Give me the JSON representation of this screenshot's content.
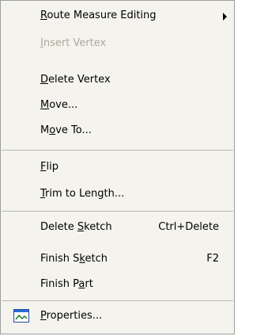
{
  "menu": {
    "route_measure_editing": {
      "label_pre": "",
      "label_u": "R",
      "label_post": "oute Measure Editing"
    },
    "insert_vertex": {
      "label_pre": "",
      "label_u": "I",
      "label_post": "nsert Vertex"
    },
    "delete_vertex": {
      "label_pre": "",
      "label_u": "D",
      "label_post": "elete Vertex"
    },
    "move": {
      "label_pre": "",
      "label_u": "M",
      "label_post": "ove..."
    },
    "move_to": {
      "label_pre": "M",
      "label_u": "o",
      "label_post": "ve To..."
    },
    "flip": {
      "label_pre": "",
      "label_u": "F",
      "label_post": "lip"
    },
    "trim_to_length": {
      "label_pre": "",
      "label_u": "T",
      "label_post": "rim to Length..."
    },
    "delete_sketch": {
      "label_pre": "Delete ",
      "label_u": "S",
      "label_post": "ketch",
      "shortcut": "Ctrl+Delete"
    },
    "finish_sketch": {
      "label_pre": "Finish S",
      "label_u": "k",
      "label_post": "etch",
      "shortcut": "F2"
    },
    "finish_part": {
      "label_pre": "Finish P",
      "label_u": "a",
      "label_post": "rt"
    },
    "properties": {
      "label_pre": "",
      "label_u": "P",
      "label_post": "roperties...",
      "icon": "properties-icon"
    }
  },
  "colors": {
    "menu_bg": "#f4f3ee",
    "disabled_text": "#aca899",
    "separator": "#b8b8b0"
  }
}
